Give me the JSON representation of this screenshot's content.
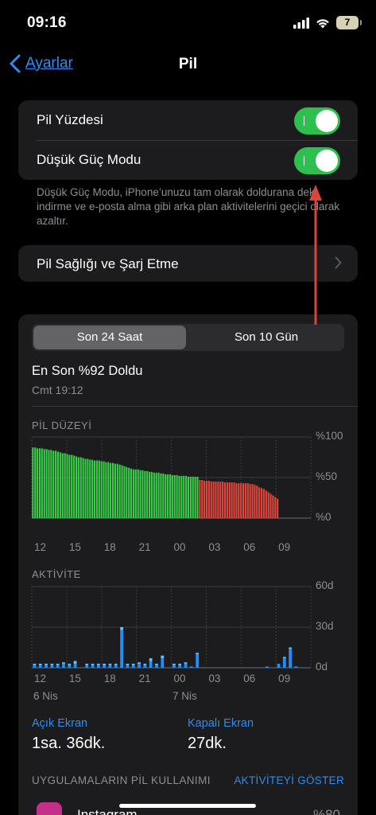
{
  "status_bar": {
    "time": "09:16",
    "battery": "7"
  },
  "nav": {
    "back_label": "Ayarlar",
    "title": "Pil"
  },
  "settings": {
    "battery_percentage": {
      "label": "Pil Yüzdesi",
      "on": true
    },
    "low_power_mode": {
      "label": "Düşük Güç Modu",
      "on": true
    },
    "footnote": "Düşük Güç Modu, iPhone’unuzu tam olarak doldurana dek indirme ve e-posta alma gibi arka plan aktivitelerini geçici olarak azaltır."
  },
  "health_row": {
    "label": "Pil Sağlığı ve Şarj Etme"
  },
  "segmented": {
    "options": [
      "Son 24 Saat",
      "Son 10 Gün"
    ],
    "selected": 0
  },
  "last_charged": {
    "title": "En Son %92 Doldu",
    "time": "Cmt 19:12"
  },
  "colors": {
    "accent": "#2e8cf0",
    "green": "#2ec04f",
    "battery_green": "#3ad14a",
    "battery_red": "#e4473d",
    "activity_blue": "#1e8ff6",
    "annotation_arrow": "#d9463a"
  },
  "chart_data": [
    {
      "type": "bar",
      "title": "PİL DÜZEYİ",
      "y_ticks": [
        "%100",
        "%50",
        "%0"
      ],
      "ylim": [
        0,
        100
      ],
      "x_ticks": [
        "12",
        "15",
        "18",
        "21",
        "00",
        "03",
        "06",
        "09"
      ],
      "grid": true,
      "series": [
        {
          "name": "",
          "color": "#3ad14a",
          "values": [
            87,
            87,
            86,
            86,
            86,
            85,
            85,
            84,
            84,
            83,
            83,
            82,
            81,
            80,
            80,
            79,
            78,
            78,
            77,
            76,
            75,
            75,
            74,
            73,
            73,
            72,
            72,
            71,
            71,
            71,
            70,
            70,
            69,
            69,
            68,
            68,
            67,
            67,
            66,
            65,
            64,
            63,
            62,
            61,
            60,
            60,
            60,
            59,
            59,
            58,
            58,
            57,
            57,
            56,
            56,
            56,
            55,
            55,
            54,
            54,
            54,
            53,
            53,
            53,
            52,
            52,
            52,
            52,
            51,
            51,
            51,
            51,
            51
          ]
        },
        {
          "name": "",
          "color": "#e4473d",
          "values": [
            47,
            47,
            46,
            46,
            46,
            45,
            45,
            45,
            45,
            45,
            45,
            44,
            44,
            44,
            44,
            44,
            43,
            43,
            43,
            43,
            43,
            43,
            42,
            42,
            41,
            40,
            38,
            37,
            36,
            34,
            32,
            30,
            28,
            26,
            24
          ]
        }
      ]
    },
    {
      "type": "bar",
      "title": "AKTİVİTE",
      "y_ticks": [
        "60d",
        "30d",
        "0d"
      ],
      "ylim": [
        0,
        60
      ],
      "x_ticks": [
        "12",
        "15",
        "18",
        "21",
        "00",
        "03",
        "06",
        "09"
      ],
      "date_labels": [
        "6 Nis",
        "7 Nis"
      ],
      "grid": true,
      "screen_on": [
        2,
        2,
        2,
        2,
        2,
        3,
        2,
        3,
        0,
        2,
        2,
        2,
        2,
        2,
        2,
        28,
        2,
        2,
        3,
        2,
        5,
        2,
        7,
        0,
        2,
        2,
        3,
        1,
        10,
        0,
        0,
        0,
        0,
        0,
        0,
        0,
        0,
        0,
        0,
        0,
        1,
        0,
        3,
        7,
        14,
        1,
        0
      ],
      "screen_off": [
        1,
        1,
        1,
        1,
        1,
        1,
        1,
        2,
        0,
        1,
        1,
        1,
        1,
        1,
        1,
        2,
        1,
        1,
        1,
        1,
        2,
        1,
        2,
        0,
        1,
        1,
        1,
        0,
        1,
        0,
        0,
        0,
        0,
        0,
        0,
        0,
        0,
        0,
        0,
        0,
        0,
        0,
        0,
        1,
        1,
        0,
        0
      ]
    }
  ],
  "usage": {
    "screen_on": {
      "label": "Açık Ekran",
      "value": "1sa. 36dk."
    },
    "screen_off": {
      "label": "Kapalı Ekran",
      "value": "27dk."
    }
  },
  "apps": {
    "header": "UYGULAMALARIN PİL KULLANIMI",
    "link": "AKTİVİTEYİ GÖSTER",
    "first_app": "Instagram",
    "first_pct": "%80"
  }
}
